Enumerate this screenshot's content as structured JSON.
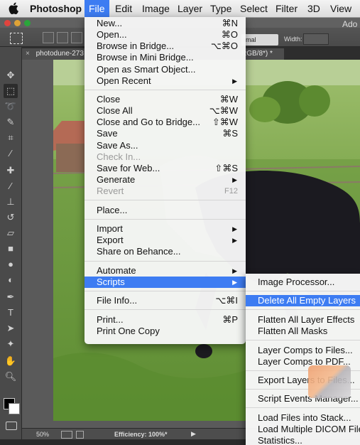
{
  "menubar": {
    "app": "Photoshop",
    "items": [
      "File",
      "Edit",
      "Image",
      "Layer",
      "Type",
      "Select",
      "Filter",
      "3D",
      "View"
    ]
  },
  "options_bar": {
    "blend_mode": "rmal",
    "width_label": "Width:",
    "app_title": "Ado"
  },
  "document": {
    "tab_title": "photodune-273",
    "tab_suffix": "RGB/8*) *"
  },
  "status": {
    "zoom": "50%",
    "efficiency": "Efficiency: 100%*"
  },
  "file_menu": {
    "items": [
      {
        "label": "New...",
        "shortcut": "⌘N"
      },
      {
        "label": "Open...",
        "shortcut": "⌘O"
      },
      {
        "label": "Browse in Bridge...",
        "shortcut": "⌥⌘O"
      },
      {
        "label": "Browse in Mini Bridge...",
        "shortcut": ""
      },
      {
        "label": "Open as Smart Object...",
        "shortcut": ""
      },
      {
        "label": "Open Recent",
        "shortcut": ""
      },
      {
        "label": "Close",
        "shortcut": "⌘W"
      },
      {
        "label": "Close All",
        "shortcut": "⌥⌘W"
      },
      {
        "label": "Close and Go to Bridge...",
        "shortcut": "⇧⌘W"
      },
      {
        "label": "Save",
        "shortcut": "⌘S"
      },
      {
        "label": "Save As...",
        "shortcut": ""
      },
      {
        "label": "Check In...",
        "shortcut": ""
      },
      {
        "label": "Save for Web...",
        "shortcut": "⇧⌘S"
      },
      {
        "label": "Generate",
        "shortcut": ""
      },
      {
        "label": "Revert",
        "shortcut": "F12"
      },
      {
        "label": "Place...",
        "shortcut": ""
      },
      {
        "label": "Import",
        "shortcut": ""
      },
      {
        "label": "Export",
        "shortcut": ""
      },
      {
        "label": "Share on Behance...",
        "shortcut": ""
      },
      {
        "label": "Automate",
        "shortcut": ""
      },
      {
        "label": "Scripts",
        "shortcut": ""
      },
      {
        "label": "File Info...",
        "shortcut": "⌥⌘I"
      },
      {
        "label": "Print...",
        "shortcut": "⌘P"
      },
      {
        "label": "Print One Copy",
        "shortcut": ""
      }
    ]
  },
  "scripts_submenu": {
    "items": [
      {
        "label": "Image Processor..."
      },
      {
        "label": "Delete All Empty Layers"
      },
      {
        "label": "Flatten All Layer Effects"
      },
      {
        "label": "Flatten All Masks"
      },
      {
        "label": "Layer Comps to Files..."
      },
      {
        "label": "Layer Comps to PDF..."
      },
      {
        "label": "Export Layers to Files..."
      },
      {
        "label": "Script Events Manager..."
      },
      {
        "label": "Load Files into Stack..."
      },
      {
        "label": "Load Multiple DICOM Files..."
      },
      {
        "label": "Statistics..."
      }
    ]
  },
  "colors": {
    "highlight": "#3d7cf2",
    "menu_bg": "#f6f6f6",
    "ps_panel": "#4a4a4a"
  }
}
